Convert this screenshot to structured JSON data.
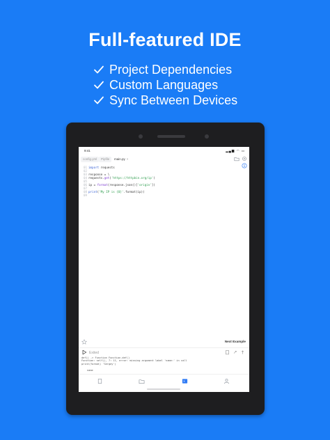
{
  "headline": "Full-featured IDE",
  "features": [
    "Project Dependencies",
    "Custom Languages",
    "Sync Between Devices"
  ],
  "device": {
    "status_time": "9:41",
    "tabs": [
      {
        "label": "config.yml",
        "active": false
      },
      {
        "label": "Pipfile",
        "active": false
      },
      {
        "label": "main.py",
        "active": true
      }
    ],
    "tab_close": "×",
    "code_lines": [
      {
        "num": "01",
        "parts": [
          {
            "t": "import",
            "c": "kw"
          },
          {
            "t": " requests",
            "c": ""
          }
        ]
      },
      {
        "num": "02",
        "parts": []
      },
      {
        "num": "03",
        "parts": [
          {
            "t": "response = \\",
            "c": ""
          }
        ]
      },
      {
        "num": "04",
        "parts": [
          {
            "t": "requests.",
            "c": ""
          },
          {
            "t": "get",
            "c": "fn"
          },
          {
            "t": "(",
            "c": ""
          },
          {
            "t": "'https://httpbin.org/ip'",
            "c": "str"
          },
          {
            "t": ")",
            "c": ""
          }
        ]
      },
      {
        "num": "05",
        "parts": []
      },
      {
        "num": "06",
        "parts": [
          {
            "t": "ip = ",
            "c": ""
          },
          {
            "t": "format",
            "c": "fn"
          },
          {
            "t": "(response.json()[",
            "c": ""
          },
          {
            "t": "'origin'",
            "c": "str"
          },
          {
            "t": "])",
            "c": ""
          }
        ]
      },
      {
        "num": "07",
        "parts": []
      },
      {
        "num": "08",
        "parts": [
          {
            "t": "print",
            "c": "kw"
          },
          {
            "t": "(",
            "c": ""
          },
          {
            "t": "'My IP is {0}'",
            "c": "str"
          },
          {
            "t": ".format(ip))",
            "c": ""
          }
        ]
      },
      {
        "num": "09",
        "parts": []
      }
    ],
    "next_example": "Next Example",
    "run_status": "Exited",
    "console_lines": [
      "def() -> Function Function.def()",
      "Function: self(), 7: 11, error: missing argument label 'name:' in call",
      "print(format) 'Sergey')",
      "",
      "name"
    ]
  },
  "colors": {
    "background": "#1a7cf6",
    "device_frame": "#1e1e20",
    "accent": "#2f7bf5",
    "keyword": "#3a63d6",
    "string": "#2a9b4a"
  },
  "icons": [
    "check-icon",
    "folder-icon",
    "settings-icon",
    "info-icon",
    "star-icon",
    "play-icon",
    "copy-icon",
    "link-icon",
    "share-icon",
    "document-icon",
    "files-icon",
    "editor-icon",
    "profile-icon"
  ]
}
